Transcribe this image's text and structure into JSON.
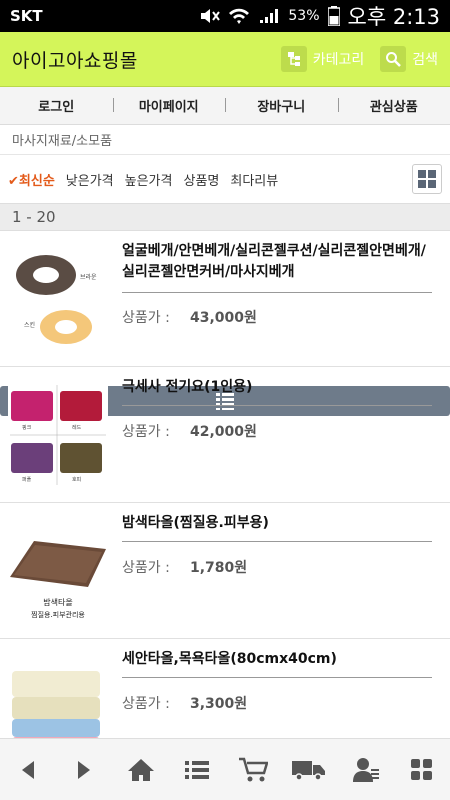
{
  "status": {
    "carrier": "SKT",
    "battery": "53%",
    "time": "오후 2:13"
  },
  "header": {
    "title": "아이고아쇼핑몰",
    "category_label": "카테고리",
    "search_label": "검색"
  },
  "nav": [
    "로그인",
    "마이페이지",
    "장바구니",
    "관심상품"
  ],
  "breadcrumb": "마사지재료/소모품",
  "sort": {
    "active_mark": "✔",
    "options": [
      "최신순",
      "낮은가격",
      "높은가격",
      "상품명",
      "최다리뷰"
    ]
  },
  "range": "1 - 20",
  "products": [
    {
      "name": "얼굴베개/안면베개/실리콘젤쿠션/실리콘젤안면베개/실리콘젤안면커버/마사지베개",
      "price_label": "상품가 :",
      "price": "43,000원",
      "thumb_labels": [
        "브라운",
        "스킨"
      ]
    },
    {
      "name": "극세사 전기요(1인용)",
      "price_label": "상품가 :",
      "price": "42,000원",
      "thumb_labels": [
        "핑크",
        "레드",
        "퍼플",
        "호피"
      ]
    },
    {
      "name": "밤색타올(찜질용.피부용)",
      "price_label": "상품가 :",
      "price": "1,780원",
      "thumb_labels": [
        "밤색타올",
        "찜질용.피부관리용"
      ]
    },
    {
      "name": "세안타올,목욕타올(80cmx40cm)",
      "price_label": "상품가 :",
      "price": "3,300원",
      "thumb_labels": []
    }
  ],
  "bottom_icons": [
    "back-arrow-icon",
    "forward-arrow-icon",
    "home-icon",
    "menu-list-icon",
    "cart-icon",
    "delivery-truck-icon",
    "my-page-icon",
    "grid-menu-icon"
  ],
  "colors": {
    "header_bg": "#d4f55a",
    "sort_active": "#e35a1a",
    "list_view_bg": "#6e7b8a",
    "icon_gray": "#555555"
  }
}
